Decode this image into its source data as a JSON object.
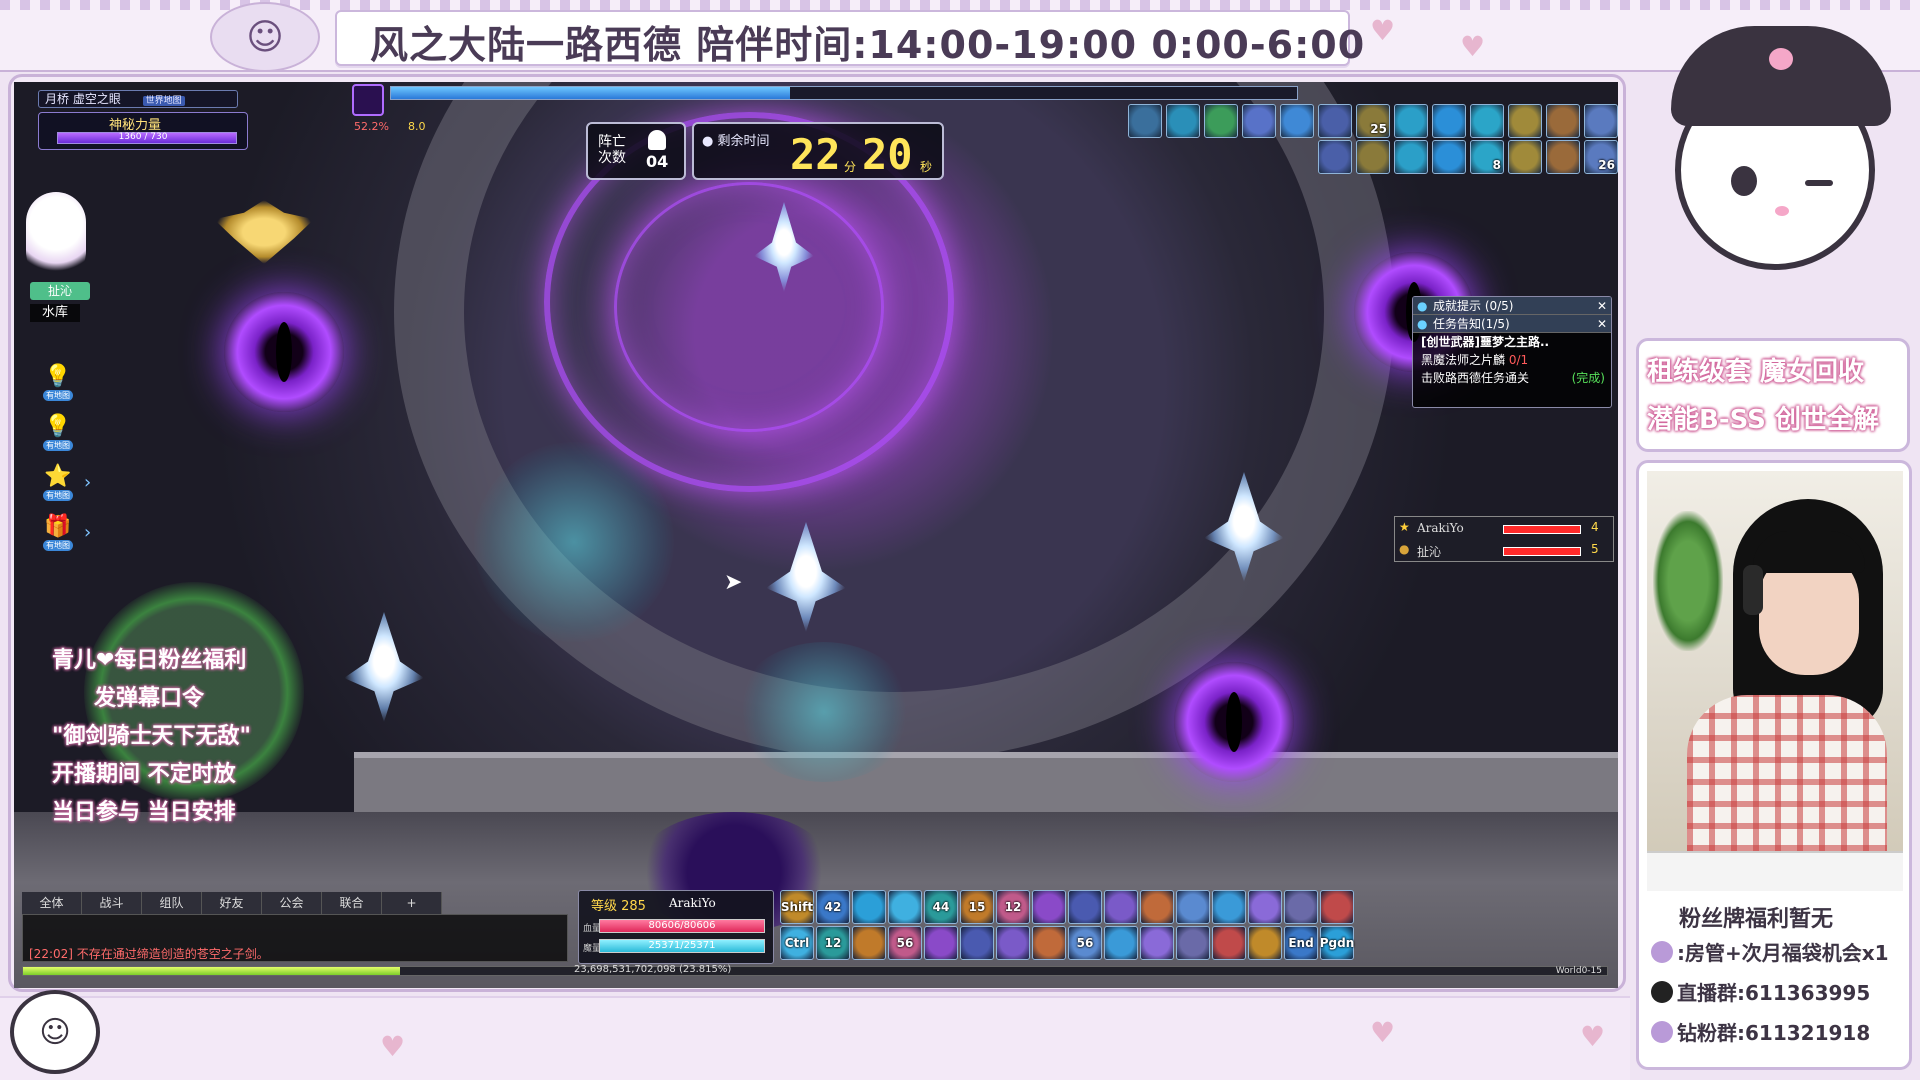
{
  "stream": {
    "title": "风之大陆一路西德   陪伴时间:14:00-19:00 0:00-6:00"
  },
  "hud": {
    "map_name": "月桥 虚空之眼",
    "map_badge": "世界地图",
    "mystic_label": "神秘力量",
    "mystic_value": "1360 / 730",
    "guild_tag": "扯沁",
    "player_nametag": "水库",
    "side_icon_tip": "有地图",
    "boss_hp_percent": "52.2%",
    "boss_sub": "8.0",
    "death_label": "阵亡 次数",
    "death_count": "04",
    "timer_label": "剩余时间",
    "timer_minutes": "22",
    "timer_min_unit": "分",
    "timer_seconds": "20",
    "timer_sec_unit": "秒"
  },
  "buffs": {
    "row1": [
      "",
      "",
      "",
      "",
      "",
      "",
      "25",
      "",
      "",
      "",
      "",
      "",
      ""
    ],
    "row2": [
      "",
      "",
      "",
      "",
      "8",
      "",
      "",
      "26"
    ],
    "colors": [
      "#3a6f9c",
      "#2a8fb8",
      "#3c9c5a",
      "#5872c8",
      "#3f89d6",
      "#4a5fa8",
      "#8a7a3a",
      "#2b9fc8",
      "#2b8fd8",
      "#2ba5c8",
      "#a08a3a",
      "#9a6a3a",
      "#5a7abf"
    ]
  },
  "quest": {
    "achievements": "成就提示 (0/5)",
    "task_notice": "任务告知(1/5)",
    "quest_title": "[创世武器]噩梦之主路..",
    "objective1": "黑魔法师之片麟",
    "objective1_count": "0/1",
    "objective2": "击败路西德任务通关",
    "objective2_status": "(完成)"
  },
  "party": [
    {
      "name": "ArakiYo",
      "level": "4"
    },
    {
      "name": "扯沁",
      "level": "5"
    }
  ],
  "fan_overlay": {
    "line1": "青儿❤每日粉丝福利",
    "line2": "发弹幕口令",
    "line3": "\"御剑骑士天下无敌\"",
    "line4": "开播期间   不定时放",
    "line5": "当日参与   当日安排"
  },
  "chat": {
    "tabs": [
      "全体",
      "战斗",
      "组队",
      "好友",
      "公会",
      "联合",
      "+"
    ],
    "message": "[22:02] 不存在通过缔造创造的苍空之子剑。"
  },
  "player": {
    "level_label": "等级 285",
    "name": "ArakiYo",
    "hp_label": "血量",
    "hp": "80606/80606",
    "mp_label": "魔量",
    "mp": "25371/25371"
  },
  "skills": {
    "row1": [
      "Shift",
      "42",
      "",
      "",
      "44",
      "15",
      "12",
      "",
      "",
      "",
      "",
      "",
      "",
      "",
      "",
      ""
    ],
    "row2": [
      "Ctrl",
      "12",
      "",
      "56",
      "",
      "",
      "",
      "",
      "56",
      "",
      "",
      "",
      "",
      "",
      "End",
      "Pgdn"
    ],
    "colors": [
      "#c08a2a",
      "#3a78c8",
      "#2b9fd8",
      "#3fb0e0",
      "#2a9a9a",
      "#c07a2a",
      "#c05a8a",
      "#8a4ac8",
      "#4a5ab0",
      "#7a5ac8",
      "#c06a3a",
      "#5a8ad0",
      "#3a9ad8",
      "#8a6ad8",
      "#6a6aa8",
      "#c04a4a"
    ]
  },
  "exp": {
    "text": "23,698,531,702,098 (23.815%)",
    "world": "World0-15"
  },
  "sidebar": {
    "promo_line1": "租练级套   魔女回收",
    "promo_line2": "潜能B-SS   创世全解",
    "fan_title": "粉丝牌福利暂无",
    "fan_line1": ":房管+次月福袋机会x1",
    "fan_line2": "直播群:611363995",
    "fan_line3": "钻粉群:611321918"
  }
}
